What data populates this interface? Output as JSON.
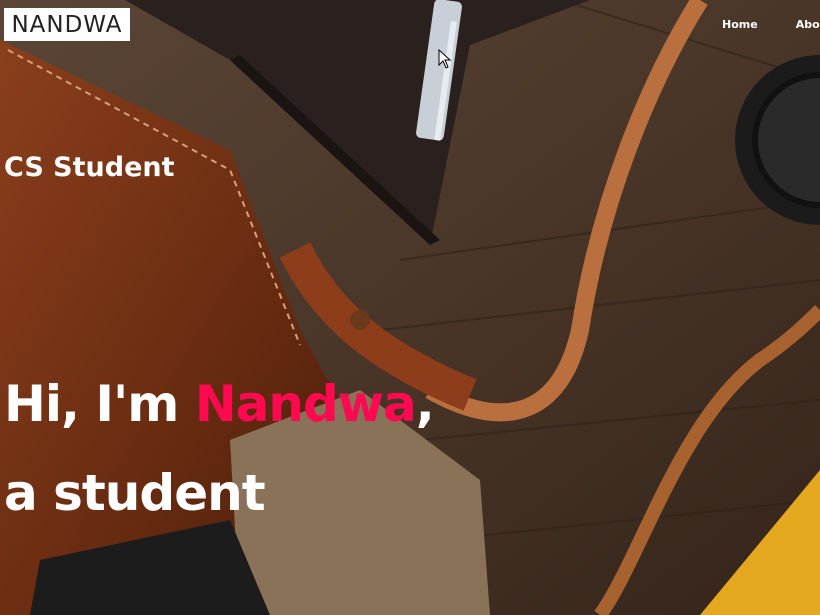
{
  "brand": {
    "logo_text": "NANDWA"
  },
  "nav": {
    "items": [
      {
        "label": "Home"
      },
      {
        "label": "About"
      }
    ]
  },
  "hero": {
    "subtitle": "CS Student",
    "greeting_prefix": "Hi, I'm ",
    "name": "Nandwa",
    "greeting_suffix": ",",
    "line2": "a student"
  },
  "colors": {
    "accent": "#ff0a50",
    "text": "#ffffff",
    "logo_bg": "#ffffff"
  }
}
